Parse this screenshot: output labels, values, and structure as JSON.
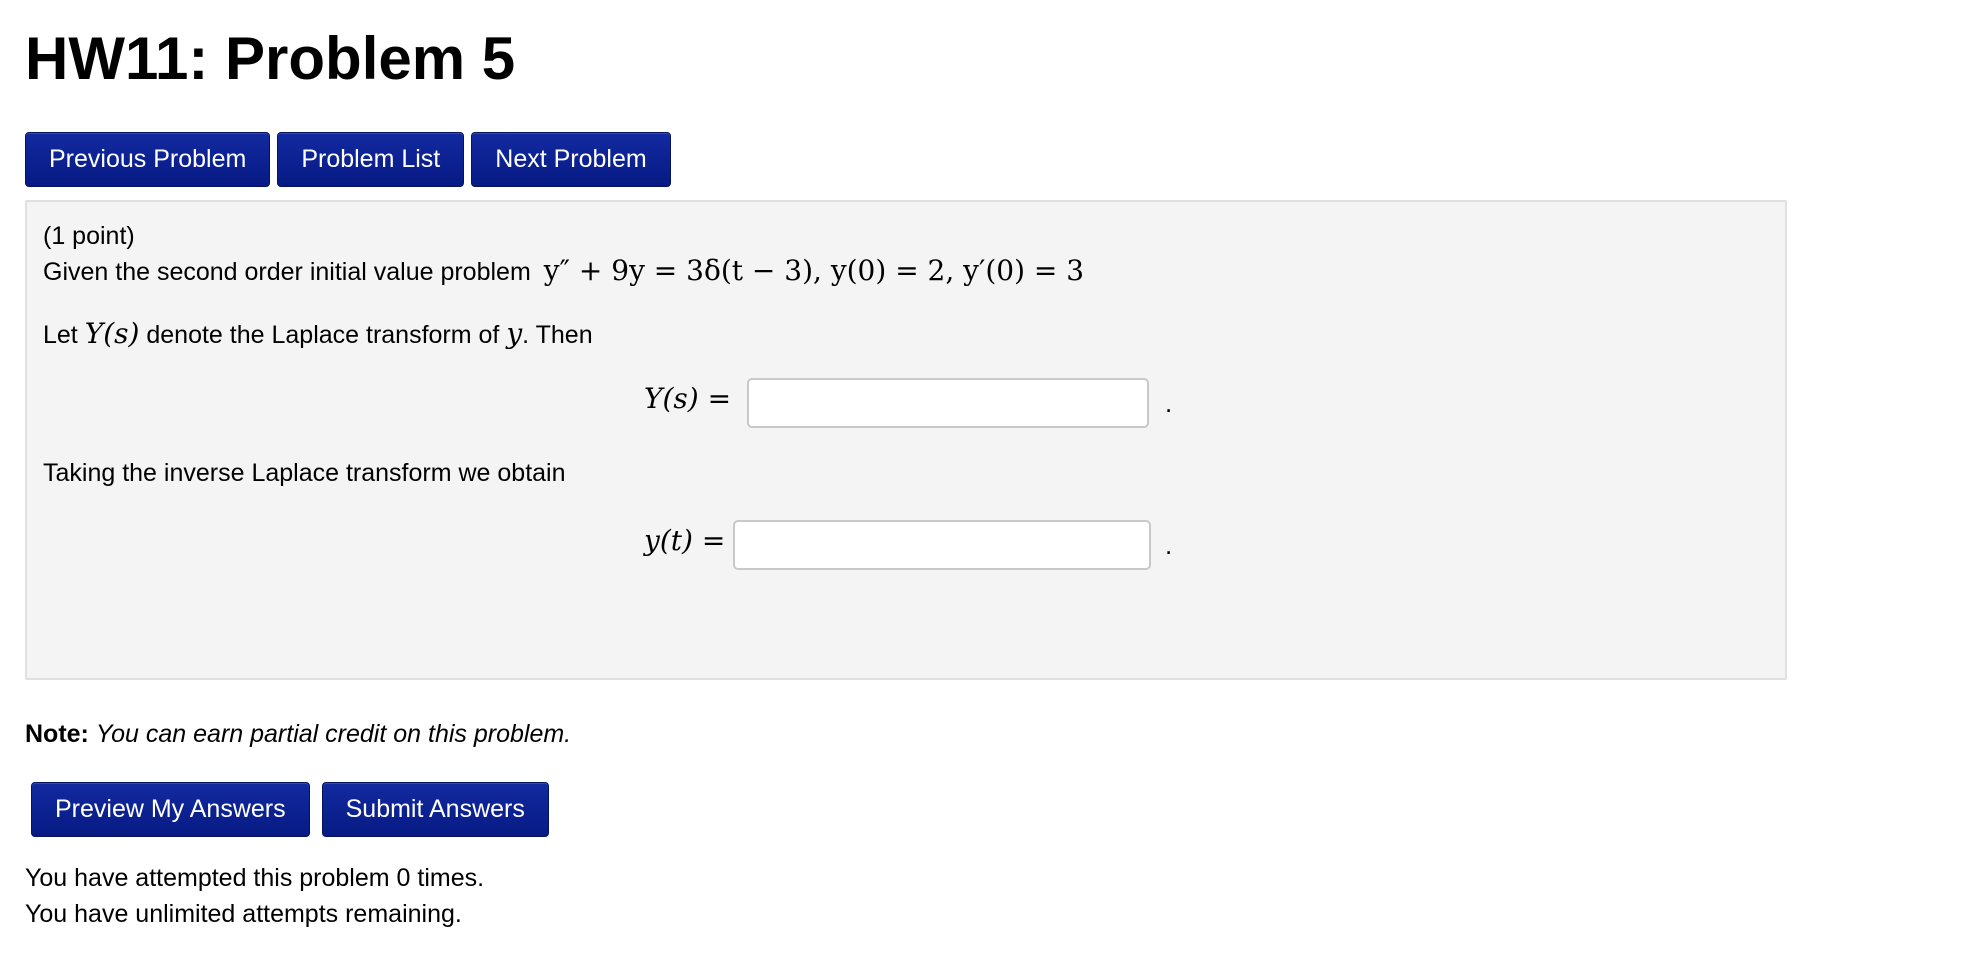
{
  "page_title": "HW11: Problem 5",
  "nav": {
    "previous": "Previous Problem",
    "list": "Problem List",
    "next": "Next Problem"
  },
  "problem": {
    "points": "(1 point)",
    "intro": "Given the second order initial value problem",
    "equation": "y″ + 9y = 3δ(t − 3),   y(0) = 2,   y′(0) = 3",
    "laplace_pre": "Let",
    "laplace_sym": "Y(s)",
    "laplace_mid": "denote the Laplace transform of",
    "laplace_var": "y",
    "laplace_post": ". Then",
    "answer1_label": "Y(s) =",
    "answer1_value": "",
    "inverse_text": "Taking the inverse Laplace transform we obtain",
    "answer2_label": "y(t) =",
    "answer2_value": "",
    "period": "."
  },
  "note": {
    "label": "Note:",
    "text": "You can earn partial credit on this problem."
  },
  "actions": {
    "preview": "Preview My Answers",
    "submit": "Submit Answers"
  },
  "status": {
    "attempts": "You have attempted this problem 0 times.",
    "remaining": "You have unlimited attempts remaining."
  },
  "colors": {
    "button": "#0a1f8f",
    "panel": "#f4f4f4"
  }
}
